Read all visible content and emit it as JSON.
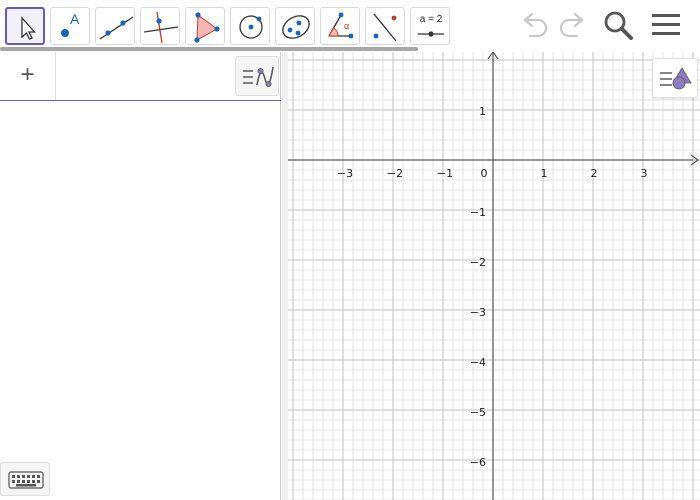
{
  "toolbar": {
    "tools": [
      {
        "name": "move-tool",
        "active": true
      },
      {
        "name": "point-tool",
        "label": "A"
      },
      {
        "name": "line-tool"
      },
      {
        "name": "perpendicular-line-tool"
      },
      {
        "name": "polygon-tool"
      },
      {
        "name": "circle-center-point-tool"
      },
      {
        "name": "conic-tool"
      },
      {
        "name": "angle-tool",
        "label": "α"
      },
      {
        "name": "reflect-tool"
      },
      {
        "name": "slider-tool",
        "label": "a = 2"
      }
    ],
    "right": [
      "undo-icon",
      "redo-icon",
      "search-icon",
      "menu-icon"
    ]
  },
  "algebra": {
    "add_label": "+",
    "input_value": "",
    "input_placeholder": ""
  },
  "graphics": {
    "x_ticks": [
      "−3",
      "−2",
      "−1",
      "0",
      "1",
      "2",
      "3"
    ],
    "y_ticks_pos": [
      "1"
    ],
    "y_ticks_neg": [
      "−1",
      "−2",
      "−3",
      "−4",
      "−5",
      "−6"
    ],
    "grid": true,
    "axis_color": "#333333",
    "major_grid_color": "#c0c0c0",
    "minor_grid_color": "#e6e6e6"
  },
  "colors": {
    "accent": "#6557d2",
    "point": "#1565c0",
    "polygon_fill": "#f5b7b1",
    "polygon_stroke": "#c0392b"
  }
}
